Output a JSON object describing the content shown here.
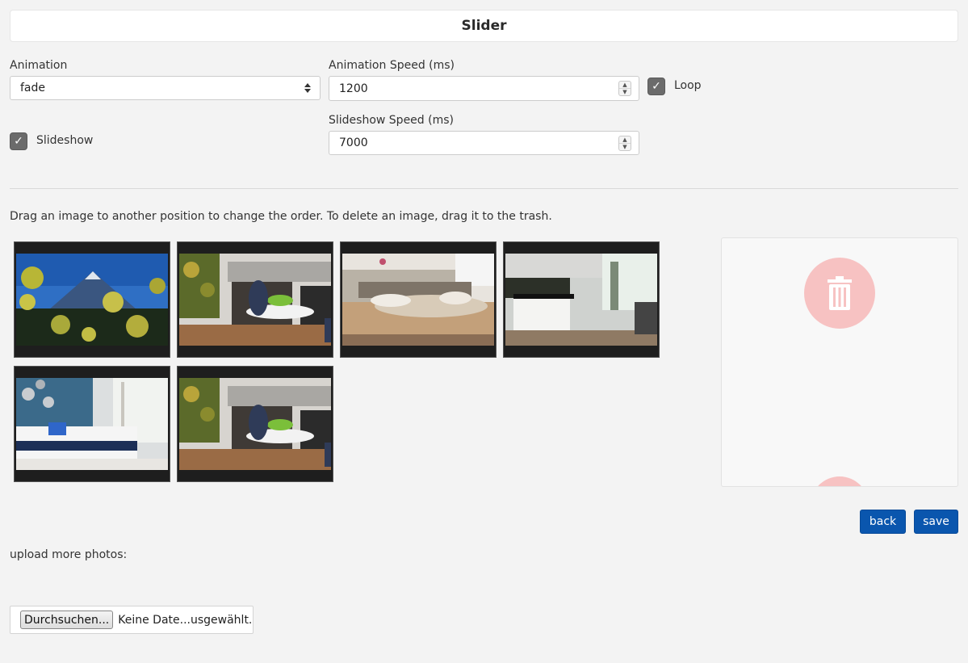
{
  "header": {
    "title": "Slider"
  },
  "settings": {
    "animation_label": "Animation",
    "animation_value": "fade",
    "animation_speed_label": "Animation Speed (ms)",
    "animation_speed_value": "1200",
    "loop_label": "Loop",
    "loop_checked": true,
    "slideshow_label": "Slideshow",
    "slideshow_checked": true,
    "slideshow_speed_label": "Slideshow Speed (ms)",
    "slideshow_speed_value": "7000",
    "check_mark": "✓"
  },
  "gallery": {
    "instructions": "Drag an image to another position to change the order. To delete an image, drag it to the trash.",
    "images": [
      {
        "subject": "mountain-landscape"
      },
      {
        "subject": "kitchen-dining"
      },
      {
        "subject": "bedroom"
      },
      {
        "subject": "open-kitchen"
      },
      {
        "subject": "hotel-bedroom"
      },
      {
        "subject": "kitchen-dining"
      }
    ]
  },
  "trash": {
    "icon": "trash-icon",
    "color": "#f7c2c2"
  },
  "actions": {
    "back_label": "back",
    "save_label": "save",
    "button_color": "#0a56ae"
  },
  "upload": {
    "label": "upload more photos:",
    "browse_label": "Durchsuchen...",
    "file_status": "Keine Date...usgewählt."
  }
}
